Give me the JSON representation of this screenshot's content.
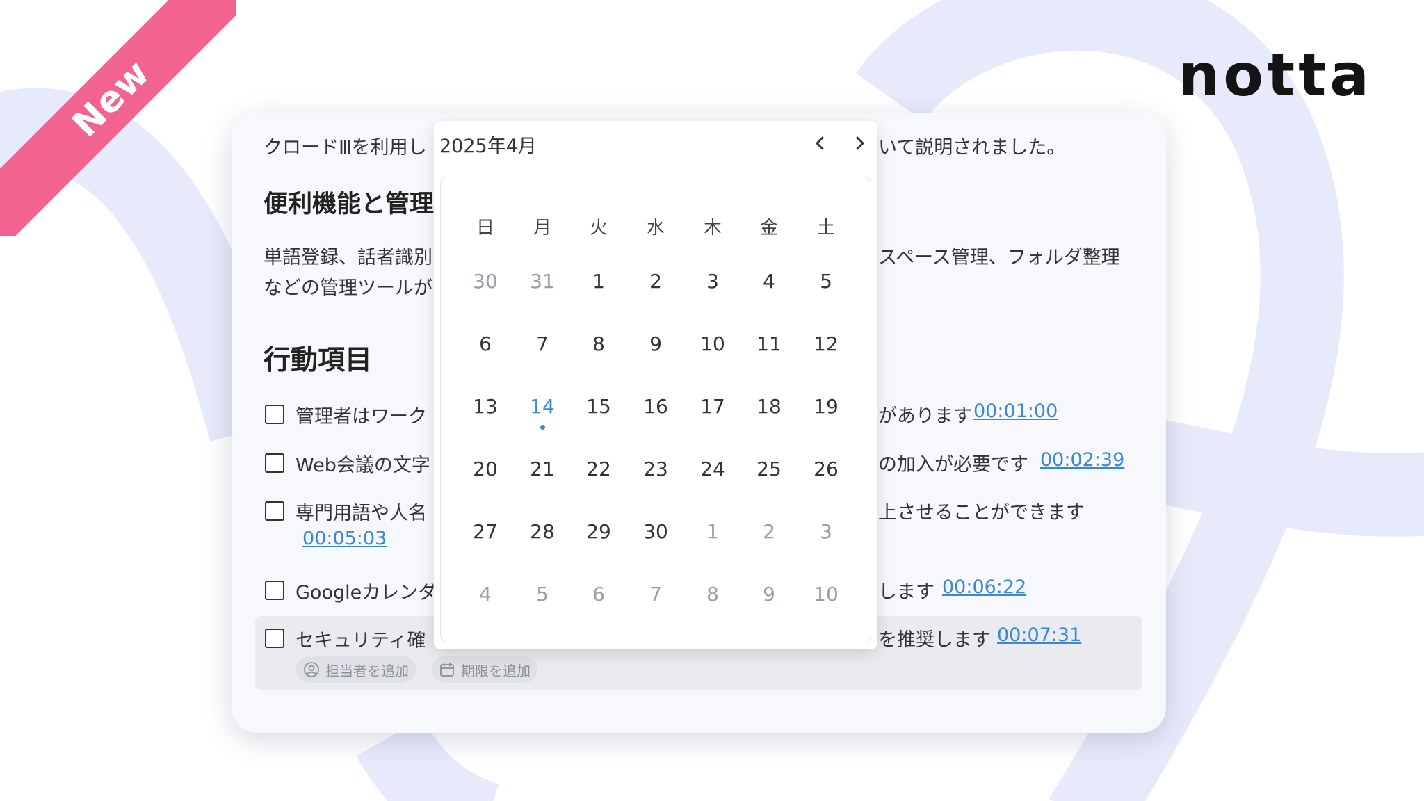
{
  "ribbon": {
    "label": "New"
  },
  "logo": {
    "text": "notta"
  },
  "summary": {
    "intro_visible_start": "クロードⅢを利用し",
    "intro_visible_end": "いて説明されました。",
    "features_heading": "便利機能と管理",
    "features_line1_start": "単語登録、話者識別",
    "features_line1_end": "スペース管理、フォルダ整理",
    "features_line2_start": "などの管理ツールが",
    "action_heading": "行動項目"
  },
  "tasks": [
    {
      "text_start": "管理者はワーク",
      "text_end": "があります",
      "timestamp": "00:01:00"
    },
    {
      "text_start": "Web会議の文字",
      "text_end": "の加入が必要です",
      "timestamp": "00:02:39"
    },
    {
      "text_start": "専門用語や人名",
      "text_end": "上させることができます",
      "timestamp": "00:05:03"
    },
    {
      "text_start": "Googleカレンダ",
      "text_end": "します",
      "timestamp": "00:06:22"
    },
    {
      "text_start": "セキュリティ確",
      "text_end": "を推奨します",
      "timestamp": "00:07:31"
    }
  ],
  "task_actions": {
    "assignee": "担当者を追加",
    "deadline": "期限を追加"
  },
  "calendar": {
    "title": "2025年4月",
    "weekdays": [
      "日",
      "月",
      "火",
      "水",
      "木",
      "金",
      "土"
    ],
    "weeks": [
      [
        "30",
        "31",
        "1",
        "2",
        "3",
        "4",
        "5"
      ],
      [
        "6",
        "7",
        "8",
        "9",
        "10",
        "11",
        "12"
      ],
      [
        "13",
        "14",
        "15",
        "16",
        "17",
        "18",
        "19"
      ],
      [
        "20",
        "21",
        "22",
        "23",
        "24",
        "25",
        "26"
      ],
      [
        "27",
        "28",
        "29",
        "30",
        "1",
        "2",
        "3"
      ],
      [
        "4",
        "5",
        "6",
        "7",
        "8",
        "9",
        "10"
      ]
    ],
    "today": "14"
  },
  "colors": {
    "accent": "#3a86d8",
    "ribbon": "#f2648f",
    "decor": "#e6e9fb"
  }
}
